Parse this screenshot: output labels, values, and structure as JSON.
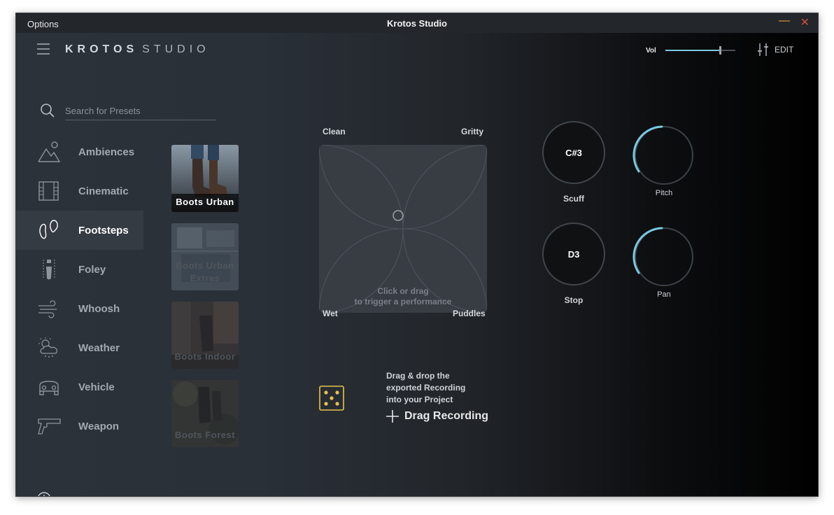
{
  "titlebar": {
    "menu_label": "Options",
    "title": "Krotos Studio",
    "minimize_symbol": "—",
    "close_symbol": "✕"
  },
  "header": {
    "brand_bold": "KROTOS",
    "brand_light": "STUDIO",
    "volume": {
      "label": "Vol",
      "level": 0.78
    },
    "edit_label": "EDIT"
  },
  "search": {
    "placeholder": "Search for Presets"
  },
  "categories": [
    {
      "label": "Ambiences",
      "icon": "mountain-icon"
    },
    {
      "label": "Cinematic",
      "icon": "film-icon"
    },
    {
      "label": "Footsteps",
      "icon": "footsteps-icon",
      "active": true
    },
    {
      "label": "Foley",
      "icon": "zipper-icon"
    },
    {
      "label": "Whoosh",
      "icon": "wind-icon"
    },
    {
      "label": "Weather",
      "icon": "weather-icon"
    },
    {
      "label": "Vehicle",
      "icon": "car-icon"
    },
    {
      "label": "Weapon",
      "icon": "gun-icon"
    }
  ],
  "presets": [
    {
      "label": "Boots Urban",
      "selected": true
    },
    {
      "label": "Boots Urban Extras"
    },
    {
      "label": "Boots Indoor"
    },
    {
      "label": "Boots Forest"
    }
  ],
  "xy_pad": {
    "top_left": "Clean",
    "top_right": "Gritty",
    "bottom_left": "Wet",
    "bottom_right": "Puddles",
    "hint_line1": "Click or drag",
    "hint_line2": "to trigger a performance"
  },
  "knobs": {
    "scuff": {
      "value": "C#3",
      "label": "Scuff"
    },
    "stop": {
      "value": "D3",
      "label": "Stop"
    },
    "pitch": {
      "label": "Pitch"
    },
    "pan": {
      "label": "Pan"
    }
  },
  "drag": {
    "line1": "Drag & drop the",
    "line2": "exported Recording",
    "line3": "into your Project",
    "button_label": "Drag Recording"
  },
  "colors": {
    "accent": "#78c9e3",
    "dice": "#e8c24a",
    "minimize": "#e7a33a",
    "close": "#d14b43"
  }
}
